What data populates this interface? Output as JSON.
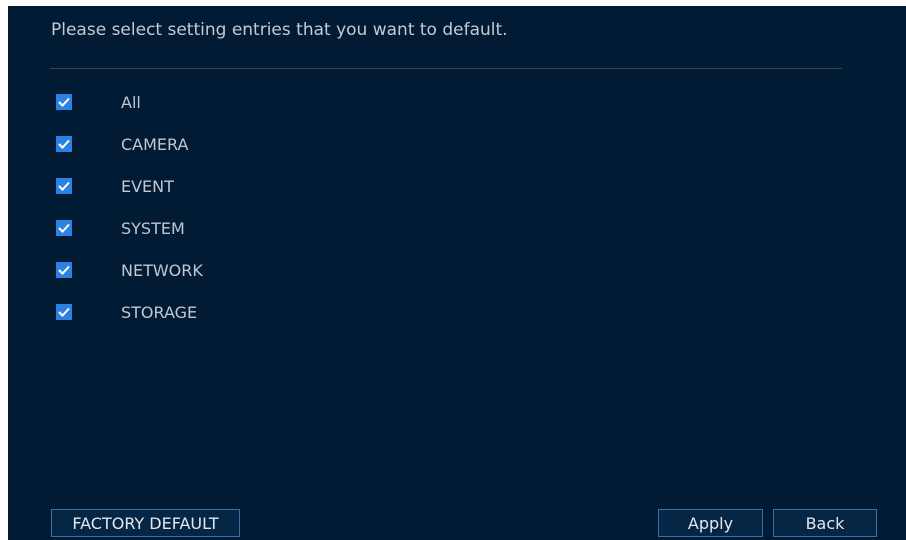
{
  "dialog": {
    "prompt": "Please select setting entries that you want to default."
  },
  "entries": [
    {
      "label": "All",
      "checked": true
    },
    {
      "label": "CAMERA",
      "checked": true
    },
    {
      "label": "EVENT",
      "checked": true
    },
    {
      "label": "SYSTEM",
      "checked": true
    },
    {
      "label": "NETWORK",
      "checked": true
    },
    {
      "label": "STORAGE",
      "checked": true
    }
  ],
  "buttons": {
    "factory_default": "FACTORY DEFAULT",
    "apply": "Apply",
    "back": "Back"
  },
  "colors": {
    "background": "#021b34",
    "checkbox": "#2c82e0",
    "button_border": "#3a6fa8",
    "text": "#c0c7d1"
  }
}
